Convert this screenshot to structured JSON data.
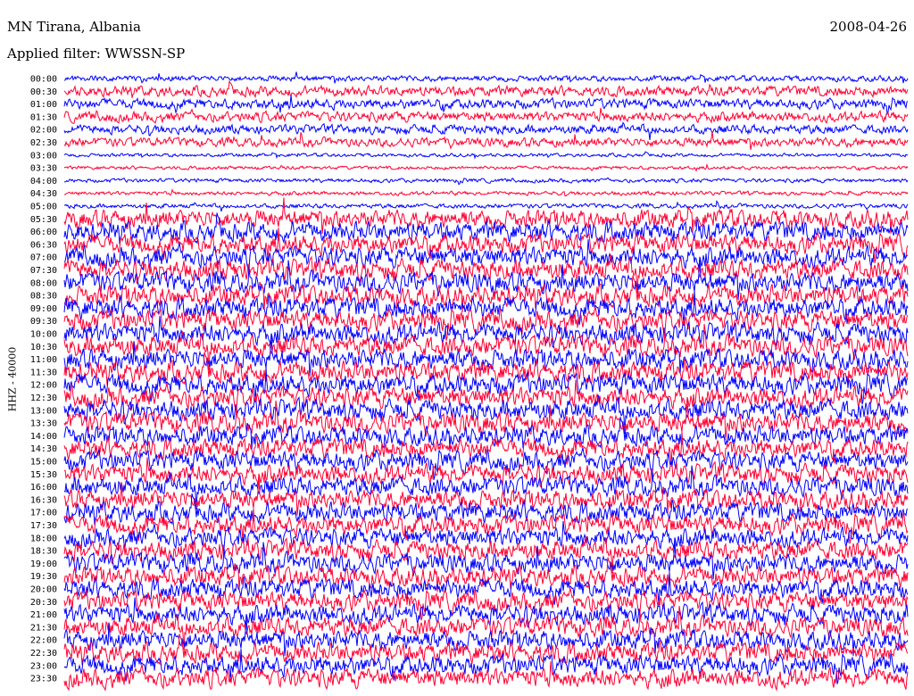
{
  "header": {
    "station": "MN Tirana, Albania",
    "date": "2008-04-26",
    "filter": "Applied filter: WWSSN-SP"
  },
  "chart_data": {
    "type": "line",
    "title": "MN Tirana, Albania",
    "ylabel": "HHZ - 40000",
    "colors": [
      "#0000ff",
      "#ff0033"
    ],
    "rows": [
      "00:00",
      "00:30",
      "01:00",
      "01:30",
      "02:00",
      "02:30",
      "03:00",
      "03:30",
      "04:00",
      "04:30",
      "05:00",
      "05:30",
      "06:00",
      "06:30",
      "07:00",
      "07:30",
      "08:00",
      "08:30",
      "09:00",
      "09:30",
      "10:00",
      "10:30",
      "11:00",
      "11:30",
      "12:00",
      "12:30",
      "13:00",
      "13:30",
      "14:00",
      "14:30",
      "15:00",
      "15:30",
      "16:00",
      "16:30",
      "17:00",
      "17:30",
      "18:00",
      "18:30",
      "19:00",
      "19:30",
      "20:00",
      "20:30",
      "21:00",
      "21:30",
      "22:00",
      "22:30",
      "23:00",
      "23:30"
    ],
    "row_amplitude": [
      0.5,
      0.9,
      0.9,
      0.9,
      0.8,
      0.8,
      0.3,
      0.3,
      0.35,
      0.35,
      0.4,
      1.6,
      1.7,
      1.7,
      1.8,
      1.8,
      1.8,
      1.8,
      1.8,
      1.8,
      1.8,
      1.8,
      1.8,
      1.8,
      1.8,
      1.8,
      1.8,
      1.8,
      1.7,
      1.7,
      1.7,
      1.7,
      1.7,
      1.7,
      1.7,
      1.7,
      1.7,
      1.7,
      1.7,
      1.7,
      1.7,
      1.7,
      1.7,
      1.7,
      1.7,
      1.7,
      1.7,
      1.7
    ]
  }
}
